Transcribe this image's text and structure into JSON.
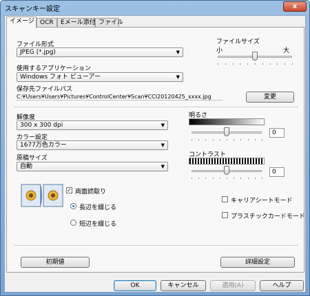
{
  "window": {
    "title": "スキャンキー設定",
    "close_label": "x"
  },
  "tabs": [
    {
      "label": "イメージ"
    },
    {
      "label": "OCR"
    },
    {
      "label": "Eメール添付"
    },
    {
      "label": "ファイル"
    }
  ],
  "file_type": {
    "label": "ファイル形式",
    "value": "JPEG (*.jpg)"
  },
  "file_size": {
    "label": "ファイルサイズ",
    "small": "小",
    "large": "大",
    "level_fraction": 0.5
  },
  "target_app": {
    "label": "使用するアプリケーション",
    "value": "Windows フォト ビューアー"
  },
  "save_path": {
    "label": "保存先ファイルパス",
    "value": "C:¥Users¥Users¥Pictures¥ControlCenter¥Scan¥CCI20120425_xxxx.jpg",
    "change_button": "変更"
  },
  "resolution": {
    "label": "解像度",
    "value": "300 x 300 dpi"
  },
  "color_mode": {
    "label": "カラー設定",
    "value": "1677万色カラー"
  },
  "doc_size": {
    "label": "原稿サイズ",
    "value": "自動"
  },
  "brightness": {
    "label": "明るさ",
    "value": "0",
    "level_fraction": 0.5
  },
  "contrast": {
    "label": "コントラスト",
    "value": "0",
    "level_fraction": 0.5
  },
  "duplex": {
    "label": "両面読取り",
    "checked": true,
    "options": [
      {
        "label": "長辺を綴じる",
        "selected": true
      },
      {
        "label": "短辺を綴じる",
        "selected": false
      }
    ]
  },
  "carrier_sheet": {
    "label": "キャリアシートモード",
    "checked": false
  },
  "plastic_card": {
    "label": "プラスチックカードモード",
    "checked": false
  },
  "buttons": {
    "defaults": "初期値",
    "advanced": "詳細設定",
    "ok": "OK",
    "cancel": "キャンセル",
    "apply": "適用(A)",
    "help": "ヘルプ"
  },
  "colors": {
    "accent": "#3c7fb1",
    "titlebar": "#9cc0e4",
    "close": "#c9452a"
  }
}
